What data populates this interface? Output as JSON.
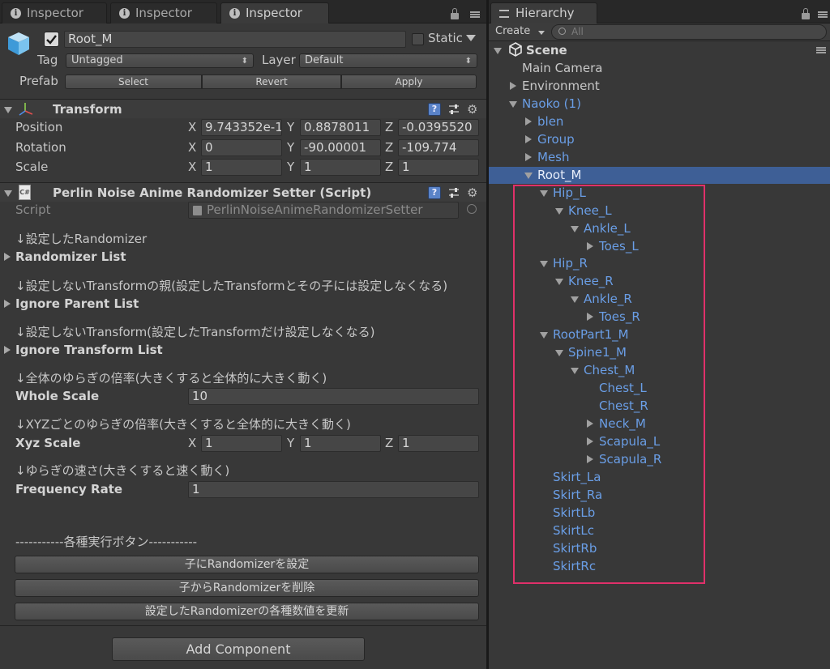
{
  "inspector": {
    "tabs": [
      {
        "label": "Inspector"
      },
      {
        "label": "Inspector"
      },
      {
        "label": "Inspector"
      }
    ],
    "object": {
      "name": "Root_M",
      "static_label": "Static",
      "tag_label": "Tag",
      "tag_value": "Untagged",
      "layer_label": "Layer",
      "layer_value": "Default",
      "prefab_label": "Prefab",
      "prefab_buttons": [
        "Select",
        "Revert",
        "Apply"
      ]
    },
    "transform": {
      "title": "Transform",
      "position_label": "Position",
      "position": {
        "x": "9.743352e-1",
        "y": "0.8878011",
        "z": "-0.0395520"
      },
      "rotation_label": "Rotation",
      "rotation": {
        "x": "0",
        "y": "-90.00001",
        "z": "-109.774"
      },
      "scale_label": "Scale",
      "scale": {
        "x": "1",
        "y": "1",
        "z": "1"
      },
      "axis_x": "X",
      "axis_y": "Y",
      "axis_z": "Z"
    },
    "script_component": {
      "title": "Perlin Noise Anime Randomizer Setter (Script)",
      "script_label": "Script",
      "script_value": "PerlinNoiseAnimeRandomizerSetter",
      "note_randomizer": "↓設定したRandomizer",
      "randomizer_list": "Randomizer List",
      "note_ignore_parent": "↓設定しないTransformの親(設定したTransformとその子には設定しなくなる)",
      "ignore_parent_list": "Ignore Parent List",
      "note_ignore_transform": "↓設定しないTransform(設定したTransformだけ設定しなくなる)",
      "ignore_transform_list": "Ignore Transform List",
      "note_whole_scale": "↓全体のゆらぎの倍率(大きくすると全体的に大きく動く)",
      "whole_scale_label": "Whole Scale",
      "whole_scale_value": "10",
      "note_xyz_scale": "↓XYZごとのゆらぎの倍率(大きくすると全体的に大きく動く)",
      "xyz_scale_label": "Xyz Scale",
      "xyz_scale": {
        "x": "1",
        "y": "1",
        "z": "1"
      },
      "note_frequency": "↓ゆらぎの速さ(大きくすると速く動く)",
      "frequency_label": "Frequency Rate",
      "frequency_value": "1",
      "buttons_divider": "-----------各種実行ボタン-----------",
      "button_set": "子にRandomizerを設定",
      "button_remove": "子からRandomizerを削除",
      "button_update": "設定したRandomizerの各種数値を更新"
    },
    "add_component": "Add Component"
  },
  "hierarchy": {
    "tab_label": "Hierarchy",
    "create_label": "Create",
    "search_placeholder": "All",
    "scene_label": "Scene",
    "items": [
      {
        "label": "Main Camera",
        "depth": 0,
        "expander": "none",
        "color": "normal"
      },
      {
        "label": "Environment",
        "depth": 0,
        "expander": "right",
        "color": "normal"
      },
      {
        "label": "Naoko (1)",
        "depth": 0,
        "expander": "down",
        "color": "blue"
      },
      {
        "label": "blen",
        "depth": 1,
        "expander": "right",
        "color": "blue"
      },
      {
        "label": "Group",
        "depth": 1,
        "expander": "right",
        "color": "blue"
      },
      {
        "label": "Mesh",
        "depth": 1,
        "expander": "right",
        "color": "blue"
      },
      {
        "label": "Root_M",
        "depth": 1,
        "expander": "down",
        "color": "selected"
      },
      {
        "label": "Hip_L",
        "depth": 2,
        "expander": "down",
        "color": "blue"
      },
      {
        "label": "Knee_L",
        "depth": 3,
        "expander": "down",
        "color": "blue"
      },
      {
        "label": "Ankle_L",
        "depth": 4,
        "expander": "down",
        "color": "blue"
      },
      {
        "label": "Toes_L",
        "depth": 5,
        "expander": "right",
        "color": "blue"
      },
      {
        "label": "Hip_R",
        "depth": 2,
        "expander": "down",
        "color": "blue"
      },
      {
        "label": "Knee_R",
        "depth": 3,
        "expander": "down",
        "color": "blue"
      },
      {
        "label": "Ankle_R",
        "depth": 4,
        "expander": "down",
        "color": "blue"
      },
      {
        "label": "Toes_R",
        "depth": 5,
        "expander": "right",
        "color": "blue"
      },
      {
        "label": "RootPart1_M",
        "depth": 2,
        "expander": "down",
        "color": "blue"
      },
      {
        "label": "Spine1_M",
        "depth": 3,
        "expander": "down",
        "color": "blue"
      },
      {
        "label": "Chest_M",
        "depth": 4,
        "expander": "down",
        "color": "blue"
      },
      {
        "label": "Chest_L",
        "depth": 5,
        "expander": "none",
        "color": "blue"
      },
      {
        "label": "Chest_R",
        "depth": 5,
        "expander": "none",
        "color": "blue"
      },
      {
        "label": "Neck_M",
        "depth": 5,
        "expander": "right",
        "color": "blue"
      },
      {
        "label": "Scapula_L",
        "depth": 5,
        "expander": "right",
        "color": "blue"
      },
      {
        "label": "Scapula_R",
        "depth": 5,
        "expander": "right",
        "color": "blue"
      },
      {
        "label": "Skirt_La",
        "depth": 2,
        "expander": "none",
        "color": "blue"
      },
      {
        "label": "Skirt_Ra",
        "depth": 2,
        "expander": "none",
        "color": "blue"
      },
      {
        "label": "SkirtLb",
        "depth": 2,
        "expander": "none",
        "color": "blue"
      },
      {
        "label": "SkirtLc",
        "depth": 2,
        "expander": "none",
        "color": "blue"
      },
      {
        "label": "SkirtRb",
        "depth": 2,
        "expander": "none",
        "color": "blue"
      },
      {
        "label": "SkirtRc",
        "depth": 2,
        "expander": "none",
        "color": "blue"
      }
    ]
  },
  "colors": {
    "panel_bg": "#383838",
    "selection": "#3e5f96",
    "link_blue": "#6a9ee6",
    "highlight_box": "#e0306a"
  },
  "icons": {
    "tab": "info-icon",
    "object": "cube-icon",
    "transform": "axes-icon",
    "script": "csharp-script-icon",
    "scene": "unity-logo-icon"
  }
}
